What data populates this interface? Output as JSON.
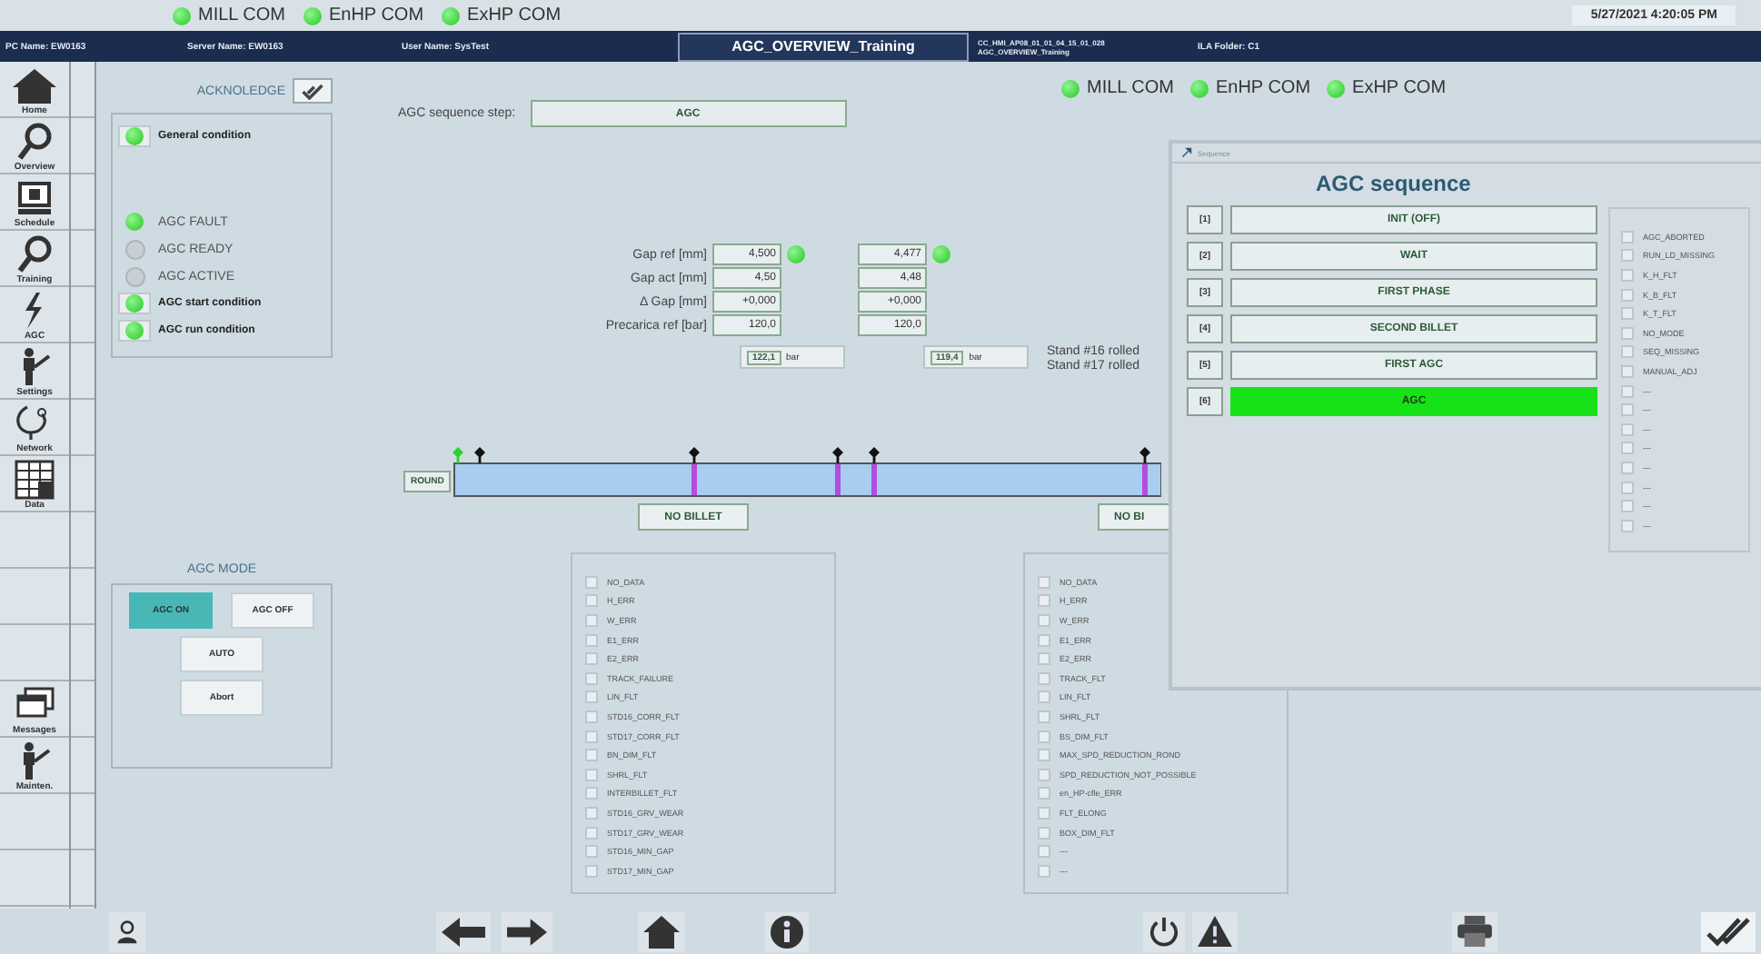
{
  "top_status": {
    "com_lights": [
      {
        "label": "MILL COM",
        "on": true
      },
      {
        "label": "EnHP COM",
        "on": true
      },
      {
        "label": "ExHP COM",
        "on": true
      }
    ],
    "datetime": "5/27/2021 4:20:05 PM"
  },
  "info_bar": {
    "pc_name": "PC Name: EW0163",
    "server_name": "Server Name: EW0163",
    "user_name": "User Name: SysTest",
    "screen_title": "AGC_OVERVIEW_Training",
    "screen_path": [
      "CC_HMI_AP08_01_01_04_15_01_028",
      "AGC_OVERVIEW_Training"
    ],
    "folder": "ILA Folder: C1"
  },
  "sidebar": {
    "top_items": [
      {
        "label": "Home",
        "kind": "home"
      },
      {
        "label": "Overview",
        "kind": "search"
      },
      {
        "label": "Schedule",
        "kind": "monitor"
      },
      {
        "label": "Training",
        "kind": "search"
      },
      {
        "label": "AGC",
        "kind": "bolt"
      },
      {
        "label": "Settings",
        "kind": "worker"
      },
      {
        "label": "Network",
        "kind": "stethoscope"
      },
      {
        "label": "Data",
        "kind": "table"
      }
    ],
    "bottom_items": [
      {
        "label": "Messages",
        "kind": "windows"
      },
      {
        "label": "Mainten.",
        "kind": "worker"
      }
    ]
  },
  "acknowledge": {
    "label": "ACKNOLEDGE"
  },
  "general_condition": {
    "label": "General condition",
    "on": true
  },
  "conditions": [
    {
      "label": "AGC FAULT",
      "kind": "plain",
      "on": true
    },
    {
      "label": "AGC READY",
      "kind": "plain",
      "on": false
    },
    {
      "label": "AGC ACTIVE",
      "kind": "plain",
      "on": false
    },
    {
      "label": "AGC start condition",
      "kind": "boxed",
      "on": true
    },
    {
      "label": "AGC run condition",
      "kind": "boxed",
      "on": true
    }
  ],
  "sequence_step": {
    "label": "AGC sequence step:",
    "value": "AGC"
  },
  "com_lights": [
    {
      "label": "MILL COM",
      "on": true
    },
    {
      "label": "EnHP COM",
      "on": true
    },
    {
      "label": "ExHP COM",
      "on": true
    }
  ],
  "gap_table": {
    "rows": [
      {
        "label": "Gap ref [mm]",
        "values": [
          "4,500",
          "4,477"
        ]
      },
      {
        "label": "Gap act [mm]",
        "values": [
          "4,50",
          "4,48"
        ]
      },
      {
        "label": "Δ Gap [mm]",
        "values": [
          "+0,000",
          "+0,000"
        ]
      },
      {
        "label": "Precarica ref [bar]",
        "values": [
          "120,0",
          "120,0"
        ]
      }
    ],
    "indicators": [
      {
        "on": true
      },
      {
        "on": true
      }
    ]
  },
  "pressure_readouts": [
    {
      "value": "122,1",
      "unit": "bar"
    },
    {
      "value": "119,4",
      "unit": "bar"
    }
  ],
  "stand_notes": [
    "Stand #16 rolled",
    "Stand #17 rolled"
  ],
  "track": {
    "label": "ROUND",
    "billet_buttons": [
      "NO BILLET",
      "NO BI"
    ]
  },
  "agc_mode": {
    "title": "AGC MODE",
    "buttons": [
      {
        "label": "AGC ON",
        "selected": true
      },
      {
        "label": "AGC OFF",
        "selected": false
      },
      {
        "label": "AUTO",
        "selected": false
      },
      {
        "label": "Abort",
        "selected": false
      }
    ]
  },
  "fault_lists": [
    [
      {
        "label": "NO_DATA",
        "checked": false
      },
      {
        "label": "H_ERR",
        "checked": false
      },
      {
        "label": "W_ERR",
        "checked": false
      },
      {
        "label": "E1_ERR",
        "checked": false
      },
      {
        "label": "E2_ERR",
        "checked": false
      },
      {
        "label": "TRACK_FAILURE",
        "checked": false
      },
      {
        "label": "LIN_FLT",
        "checked": false
      },
      {
        "label": "STD16_CORR_FLT",
        "checked": false
      },
      {
        "label": "STD17_CORR_FLT",
        "checked": false
      },
      {
        "label": "BN_DIM_FLT",
        "checked": false
      },
      {
        "label": "SHRL_FLT",
        "checked": false
      },
      {
        "label": "INTERBILLET_FLT",
        "checked": false
      },
      {
        "label": "STD16_GRV_WEAR",
        "checked": false
      },
      {
        "label": "STD17_GRV_WEAR",
        "checked": false
      },
      {
        "label": "STD16_MIN_GAP",
        "checked": false
      },
      {
        "label": "STD17_MIN_GAP",
        "checked": false
      }
    ],
    [
      {
        "label": "NO_DATA",
        "checked": false
      },
      {
        "label": "H_ERR",
        "checked": false
      },
      {
        "label": "W_ERR",
        "checked": false
      },
      {
        "label": "E1_ERR",
        "checked": false
      },
      {
        "label": "E2_ERR",
        "checked": false
      },
      {
        "label": "TRACK_FLT",
        "checked": false
      },
      {
        "label": "LIN_FLT",
        "checked": false
      },
      {
        "label": "SHRL_FLT",
        "checked": false
      },
      {
        "label": "BS_DIM_FLT",
        "checked": false
      },
      {
        "label": "MAX_SPD_REDUCTION_ROND",
        "checked": false
      },
      {
        "label": "SPD_REDUCTION_NOT_POSSIBLE",
        "checked": false
      },
      {
        "label": "en_HP-cfle_ERR",
        "checked": false
      },
      {
        "label": "FLT_ELONG",
        "checked": false
      },
      {
        "label": "BOX_DIM_FLT",
        "checked": false
      },
      {
        "label": "---",
        "checked": false
      },
      {
        "label": "---",
        "checked": false
      }
    ]
  ],
  "sequence_window": {
    "title": "Sequence",
    "heading": "AGC sequence",
    "steps": [
      {
        "index": "[1]",
        "label": "INIT (OFF)",
        "selected": false
      },
      {
        "index": "[2]",
        "label": "WAIT",
        "selected": false
      },
      {
        "index": "[3]",
        "label": "FIRST PHASE",
        "selected": false
      },
      {
        "index": "[4]",
        "label": "SECOND BILLET",
        "selected": false
      },
      {
        "index": "[5]",
        "label": "FIRST AGC",
        "selected": false
      },
      {
        "index": "[6]",
        "label": "AGC",
        "selected": true
      }
    ],
    "flags": [
      {
        "label": "AGC_ABORTED",
        "checked": false
      },
      {
        "label": "RUN_LD_MISSING",
        "checked": false
      },
      {
        "label": "K_H_FLT",
        "checked": false
      },
      {
        "label": "K_B_FLT",
        "checked": false
      },
      {
        "label": "K_T_FLT",
        "checked": false
      },
      {
        "label": "NO_MODE",
        "checked": false
      },
      {
        "label": "SEQ_MISSING",
        "checked": false
      },
      {
        "label": "MANUAL_ADJ",
        "checked": false
      },
      {
        "label": "---",
        "checked": false
      },
      {
        "label": "---",
        "checked": false
      },
      {
        "label": "---",
        "checked": false
      },
      {
        "label": "---",
        "checked": false
      },
      {
        "label": "---",
        "checked": false
      },
      {
        "label": "---",
        "checked": false
      },
      {
        "label": "---",
        "checked": false
      },
      {
        "label": "---",
        "checked": false
      }
    ]
  }
}
